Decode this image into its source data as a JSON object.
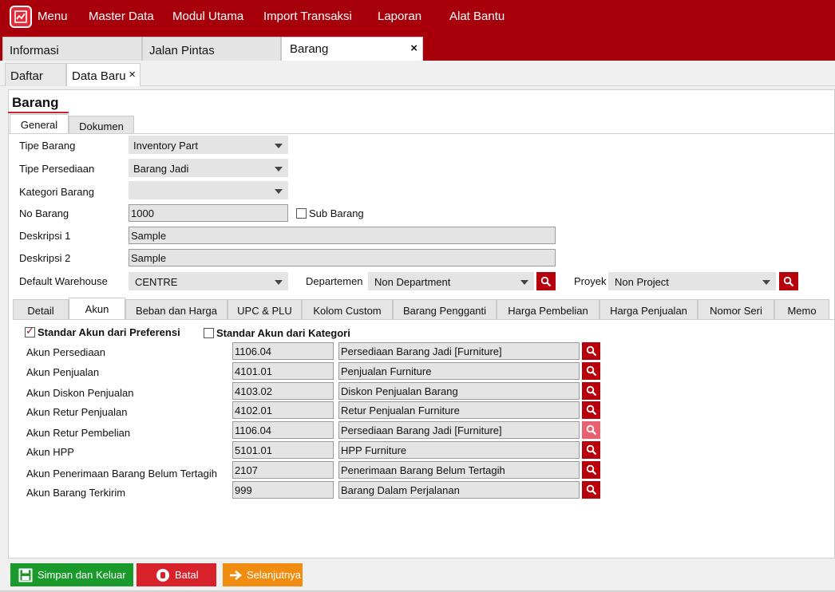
{
  "menubar": {
    "items": [
      "Menu",
      "Master Data",
      "Modul Utama",
      "Import Transaksi",
      "Laporan",
      "Alat Bantu"
    ]
  },
  "main_tabs": [
    {
      "label": "Informasi"
    },
    {
      "label": "Jalan Pintas"
    },
    {
      "label": "Barang",
      "close": "×"
    }
  ],
  "sub_tabs": [
    {
      "label": "Daftar"
    },
    {
      "label": "Data Baru",
      "close": "×"
    }
  ],
  "page_title": "Barang",
  "section_tabs": [
    "General",
    "Dokumen"
  ],
  "form": {
    "tipe_barang": {
      "label": "Tipe Barang",
      "value": "Inventory Part"
    },
    "tipe_persediaan": {
      "label": "Tipe Persediaan",
      "value": "Barang Jadi"
    },
    "kategori_barang": {
      "label": "Kategori Barang",
      "value": ""
    },
    "no_barang": {
      "label": "No Barang",
      "value": "1000"
    },
    "sub_barang": {
      "label": "Sub Barang",
      "checked": false
    },
    "deskripsi1": {
      "label": "Deskripsi 1",
      "value": "Sample"
    },
    "deskripsi2": {
      "label": "Deskripsi 2",
      "value": "Sample"
    },
    "default_warehouse": {
      "label": "Default Warehouse",
      "value": "CENTRE"
    },
    "departemen": {
      "label": "Departemen",
      "value": "Non Department"
    },
    "proyek": {
      "label": "Proyek",
      "value": "Non Project"
    }
  },
  "detail_tabs": [
    "Detail",
    "Akun",
    "Beban dan Harga",
    "UPC & PLU",
    "Kolom Custom",
    "Barang Pengganti",
    "Harga Pembelian",
    "Harga Penjualan",
    "Nomor Seri",
    "Memo"
  ],
  "akun": {
    "std_preferensi": {
      "label": "Standar Akun dari Preferensi",
      "checked": true
    },
    "std_kategori": {
      "label": "Standar Akun dari Kategori",
      "checked": false
    },
    "rows": [
      {
        "label": "Akun Persediaan",
        "code": "1106.04",
        "name": "Persediaan Barang Jadi [Furniture]"
      },
      {
        "label": "Akun Penjualan",
        "code": "4101.01",
        "name": "Penjualan Furniture"
      },
      {
        "label": "Akun Diskon Penjualan",
        "code": "4103.02",
        "name": "Diskon Penjualan Barang"
      },
      {
        "label": "Akun Retur Penjualan",
        "code": "4102.01",
        "name": "Retur Penjualan Furniture"
      },
      {
        "label": "Akun Retur Pembelian",
        "code": "1106.04",
        "name": "Persediaan Barang Jadi [Furniture]"
      },
      {
        "label": "Akun HPP",
        "code": "5101.01",
        "name": "HPP Furniture"
      },
      {
        "label": "Akun Penerimaan Barang Belum Tertagih",
        "code": "2107",
        "name": "Penerimaan Barang Belum Tertagih"
      },
      {
        "label": "Akun Barang Terkirim",
        "code": "999",
        "name": "Barang Dalam Perjalanan"
      }
    ]
  },
  "buttons": {
    "save": {
      "label": "Simpan dan Keluar",
      "color": "#1a9a2a"
    },
    "cancel": {
      "label": "Batal",
      "color": "#d8222b"
    },
    "next": {
      "label": "Selanjutnya",
      "color": "#f08c10"
    }
  },
  "colors": {
    "brand": "#a8000b",
    "search": "#b8000c"
  }
}
